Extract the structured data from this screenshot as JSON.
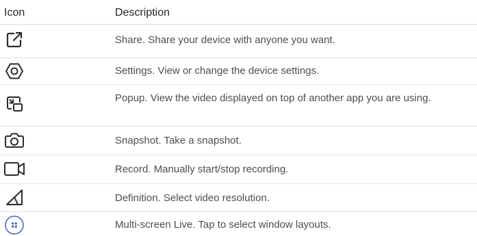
{
  "table": {
    "headers": {
      "icon": "Icon",
      "description": "Description"
    },
    "rows": [
      {
        "icon": "share-icon",
        "description": "Share. Share your device with anyone you want."
      },
      {
        "icon": "settings-icon",
        "description": "Settings. View or change the device settings."
      },
      {
        "icon": "popup-icon",
        "description": "Popup. View the video displayed on top of another app you are using."
      },
      {
        "icon": "snapshot-icon",
        "description": "Snapshot. Take a snapshot."
      },
      {
        "icon": "record-icon",
        "description": "Record. Manually start/stop recording."
      },
      {
        "icon": "definition-icon",
        "description": "Definition. Select video resolution."
      },
      {
        "icon": "multi-screen-live-icon",
        "description": "Multi-screen Live. Tap to select window layouts."
      }
    ]
  },
  "colors": {
    "icon_stroke": "#2b2b2b",
    "multi_screen_accent": "#3d5fc4",
    "text": "#4d4d4d",
    "divider": "#e3e3e3"
  }
}
